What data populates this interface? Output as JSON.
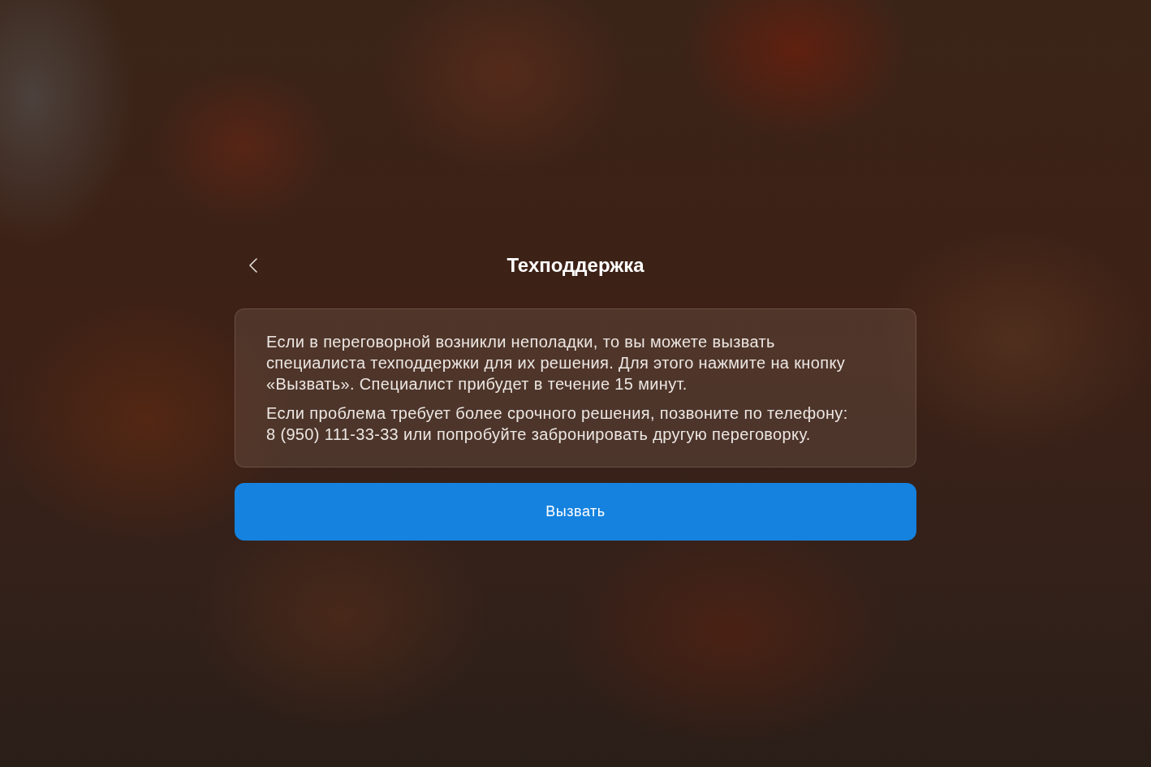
{
  "header": {
    "title": "Техподдержка"
  },
  "card": {
    "paragraphs": [
      "Если в переговорной возникли неполадки, то вы можете вызвать специалиста техподдержки для их решения. Для этого нажмите на кнопку «Вызвать». Специалист прибудет в течение 15 минут.",
      "Если проблема требует более срочного решения, позвоните по телефону: 8 (950) 111-33-33 или попробуйте забронировать другую переговорку."
    ]
  },
  "button": {
    "label": "Вызвать"
  }
}
